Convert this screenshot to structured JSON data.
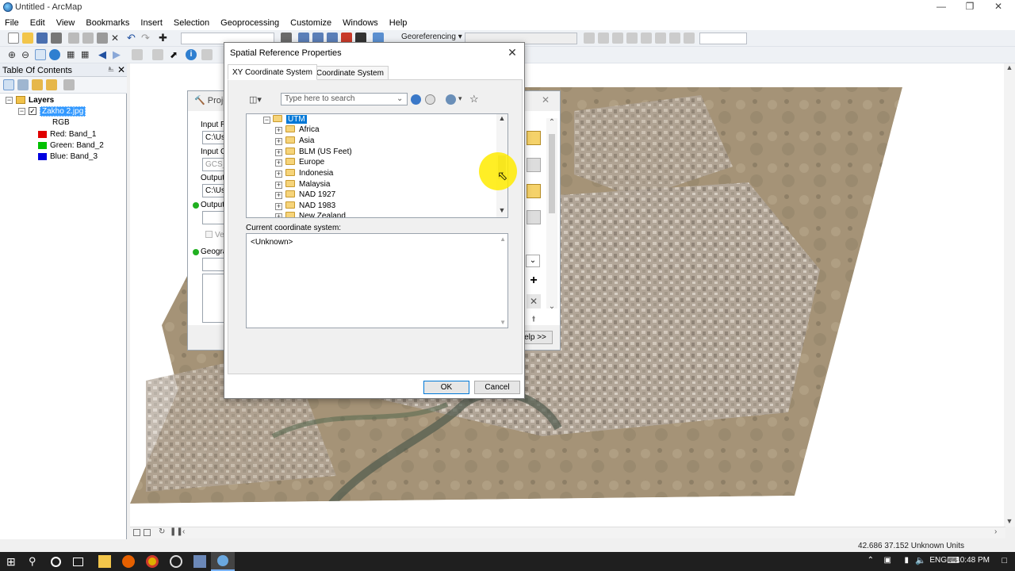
{
  "window": {
    "title": "Untitled - ArcMap"
  },
  "menu": [
    "File",
    "Edit",
    "View",
    "Bookmarks",
    "Insert",
    "Selection",
    "Geoprocessing",
    "Customize",
    "Windows",
    "Help"
  ],
  "toolbar": {
    "georeferencing_label": "Georeferencing"
  },
  "toc": {
    "title": "Table Of Contents",
    "layers_label": "Layers",
    "layer_name": "Zakho 2.jpg",
    "rgb_label": "RGB",
    "bands": [
      {
        "label": "Red:",
        "band": "Band_1",
        "color": "#e00000"
      },
      {
        "label": "Green:",
        "band": "Band_2",
        "color": "#00c000"
      },
      {
        "label": "Blue:",
        "band": "Band_3",
        "color": "#0000e0"
      }
    ]
  },
  "project_dialog": {
    "title": "Proje",
    "labels": [
      "Input R",
      "Input C",
      "Output",
      "Output",
      "Geogra"
    ],
    "fields": [
      "C:\\Use",
      "GCS_V",
      "C:\\Use"
    ],
    "verify_label": "Veri",
    "help_button": "elp >>"
  },
  "sr_dialog": {
    "title": "Spatial Reference Properties",
    "tabs": [
      "XY Coordinate System",
      "Z Coordinate System"
    ],
    "search_placeholder": "Type here to search",
    "tree": {
      "root": "UTM",
      "children": [
        "Africa",
        "Asia",
        "BLM (US Feet)",
        "Europe",
        "Indonesia",
        "Malaysia",
        "NAD 1927",
        "NAD 1983",
        "New Zealand"
      ]
    },
    "current_label": "Current coordinate system:",
    "current_value": "<Unknown>",
    "ok": "OK",
    "cancel": "Cancel"
  },
  "status": {
    "coordinates": "42.686  37.152 Unknown Units"
  },
  "taskbar": {
    "lang": "ENG",
    "time": "10:48 PM"
  }
}
